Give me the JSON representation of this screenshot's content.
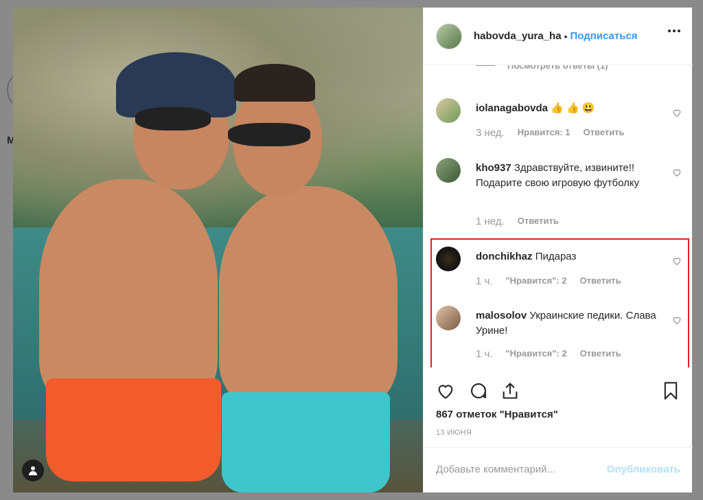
{
  "post": {
    "username": "habovda_yura_ha",
    "follow_label": "Подписаться",
    "separator": "•"
  },
  "comments": {
    "view_replies": "Посмотреть ответы (1)",
    "items": [
      {
        "username": "iolanagabovda",
        "text": "👍 👍 😃",
        "time": "3 нед.",
        "likes": "Нравится: 1",
        "reply": "Ответить"
      },
      {
        "username": "kho937",
        "text": "Здравствуйте, извините!! Подарите свою игровую футболку",
        "time": "1 нед.",
        "likes": "",
        "reply": "Ответить"
      },
      {
        "username": "donchikhaz",
        "text": "Пидараз",
        "time": "1 ч.",
        "likes": "\"Нравится\": 2",
        "reply": "Ответить"
      },
      {
        "username": "malosolov",
        "text": "Украинские педики. Слава Урине!",
        "time": "1 ч.",
        "likes": "\"Нравится\": 2",
        "reply": "Ответить"
      }
    ]
  },
  "stats": {
    "likes_label": "867 отметок \"Нравится\"",
    "date": "13 ИЮНЯ"
  },
  "composer": {
    "placeholder": "Добавьте комментарий...",
    "publish_label": "Опубликовать"
  },
  "background": {
    "letter": "M"
  },
  "colors": {
    "accent": "#3897f0",
    "highlight": "#e0201f",
    "muted": "#999999",
    "publish_disabled": "#b2dffc"
  },
  "icons": [
    "heart-icon",
    "comment-icon",
    "share-icon",
    "bookmark-icon",
    "more-icon",
    "user-tag-icon"
  ]
}
